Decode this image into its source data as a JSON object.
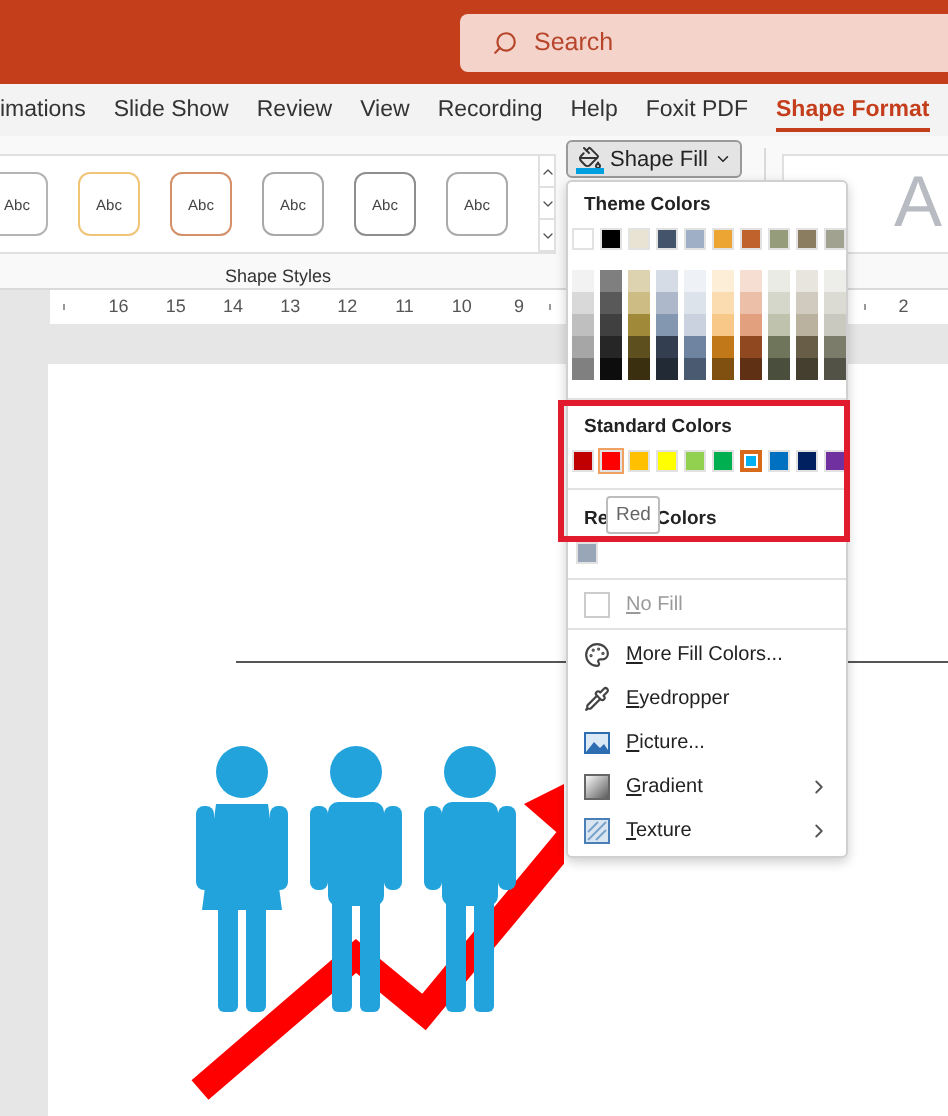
{
  "title_bar": {
    "search": {
      "placeholder": "Search"
    }
  },
  "tabs": [
    {
      "label": "imations",
      "selected": false
    },
    {
      "label": "Slide Show",
      "selected": false
    },
    {
      "label": "Review",
      "selected": false
    },
    {
      "label": "View",
      "selected": false
    },
    {
      "label": "Recording",
      "selected": false
    },
    {
      "label": "Help",
      "selected": false
    },
    {
      "label": "Foxit PDF",
      "selected": false
    },
    {
      "label": "Shape Format",
      "selected": true
    }
  ],
  "ribbon": {
    "shape_styles": [
      {
        "label": "Abc",
        "color": "#b4b4b4"
      },
      {
        "label": "Abc",
        "color": "#f2c478"
      },
      {
        "label": "Abc",
        "color": "#d49068"
      },
      {
        "label": "Abc",
        "color": "#a8a8a8"
      },
      {
        "label": "Abc",
        "color": "#8e8e8e"
      },
      {
        "label": "Abc",
        "color": "#ababab"
      }
    ],
    "group_label": "Shape Styles",
    "shape_fill_button": {
      "label": "Shape Fill",
      "expanded": true
    },
    "wordart_preview": "A"
  },
  "ruler": {
    "left_labels": [
      "16",
      "15",
      "14",
      "13",
      "12",
      "11",
      "10",
      "9"
    ],
    "right_labels": [
      "2"
    ]
  },
  "shape_fill_menu": {
    "theme_colors": {
      "title": "Theme Colors",
      "base": [
        {
          "color": "#ffffff"
        },
        {
          "color": "#000000"
        },
        {
          "color": "#e8e3d3"
        },
        {
          "color": "#44546a"
        },
        {
          "color": "#9fb0c6"
        },
        {
          "color": "#eca433"
        },
        {
          "color": "#c0622c"
        },
        {
          "color": "#949c7c"
        },
        {
          "color": "#8b7d60"
        },
        {
          "color": "#a2a290"
        }
      ],
      "shades": [
        [
          {
            "color": "#f2f2f2"
          },
          {
            "color": "#7f7f7f"
          },
          {
            "color": "#ddd3b0"
          },
          {
            "color": "#d6dce5"
          },
          {
            "color": "#eef1f5"
          },
          {
            "color": "#fdeed8"
          },
          {
            "color": "#f6dfd2"
          },
          {
            "color": "#eaebe4"
          },
          {
            "color": "#e8e5df"
          },
          {
            "color": "#ededea"
          }
        ],
        [
          {
            "color": "#d9d9d9"
          },
          {
            "color": "#595959"
          },
          {
            "color": "#cdbd84"
          },
          {
            "color": "#adb9ca"
          },
          {
            "color": "#dde3eb"
          },
          {
            "color": "#fbdcb0"
          },
          {
            "color": "#ecc0a8"
          },
          {
            "color": "#d4d7c9"
          },
          {
            "color": "#d1cbbf"
          },
          {
            "color": "#dbdbd4"
          }
        ],
        [
          {
            "color": "#bfbfbf"
          },
          {
            "color": "#404040"
          },
          {
            "color": "#a08a3a"
          },
          {
            "color": "#8497b0"
          },
          {
            "color": "#c9d2de"
          },
          {
            "color": "#f8c888"
          },
          {
            "color": "#e2a07e"
          },
          {
            "color": "#bfc3ad"
          },
          {
            "color": "#bab19f"
          },
          {
            "color": "#c9c9bf"
          }
        ],
        [
          {
            "color": "#a6a6a6"
          },
          {
            "color": "#262626"
          },
          {
            "color": "#5e4f1e"
          },
          {
            "color": "#333f50"
          },
          {
            "color": "#6f84a0"
          },
          {
            "color": "#c07818"
          },
          {
            "color": "#904820"
          },
          {
            "color": "#6e755a"
          },
          {
            "color": "#685e48"
          },
          {
            "color": "#7c7c6a"
          }
        ],
        [
          {
            "color": "#808080"
          },
          {
            "color": "#0d0d0d"
          },
          {
            "color": "#3a3010"
          },
          {
            "color": "#222a35"
          },
          {
            "color": "#4a5a70"
          },
          {
            "color": "#805010"
          },
          {
            "color": "#603015"
          },
          {
            "color": "#4a4e3c"
          },
          {
            "color": "#453f30"
          },
          {
            "color": "#525246"
          }
        ]
      ]
    },
    "standard_colors": {
      "title": "Standard Colors",
      "items": [
        {
          "color": "#c00000",
          "selected": false,
          "hovered": false
        },
        {
          "color": "#ff0000",
          "selected": false,
          "hovered": true
        },
        {
          "color": "#ffc000",
          "selected": false,
          "hovered": false
        },
        {
          "color": "#ffff00",
          "selected": false,
          "hovered": false
        },
        {
          "color": "#92d050",
          "selected": false,
          "hovered": false
        },
        {
          "color": "#00b050",
          "selected": false,
          "hovered": false
        },
        {
          "color": "#00b0f0",
          "selected": true,
          "hovered": false
        },
        {
          "color": "#0070c0",
          "selected": false,
          "hovered": false
        },
        {
          "color": "#002060",
          "selected": false,
          "hovered": false
        },
        {
          "color": "#7030a0",
          "selected": false,
          "hovered": false
        }
      ]
    },
    "recent_colors": {
      "title_parts": [
        "Re",
        "Colors"
      ],
      "items": [
        {
          "color": "#98a6b8"
        }
      ]
    },
    "tooltip": "Red",
    "items": [
      {
        "kind": "no_fill",
        "label": "No Fill",
        "disabled": true,
        "submenu": false
      },
      {
        "kind": "palette",
        "label": "More Fill Colors...",
        "disabled": false,
        "submenu": false
      },
      {
        "kind": "eyedropper",
        "label": "Eyedropper",
        "disabled": false,
        "submenu": false
      },
      {
        "kind": "picture",
        "label": "Picture...",
        "disabled": false,
        "submenu": false
      },
      {
        "kind": "gradient",
        "label": "Gradient",
        "disabled": false,
        "submenu": true
      },
      {
        "kind": "texture",
        "label": "Texture",
        "disabled": false,
        "submenu": true
      }
    ]
  },
  "highlight_frame": true
}
